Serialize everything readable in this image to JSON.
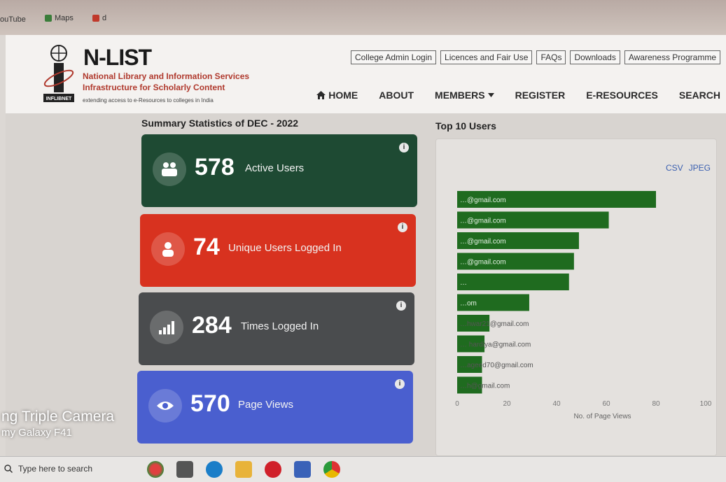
{
  "browser": {
    "bookmarks": [
      "ouTube",
      "Maps",
      "d"
    ]
  },
  "site": {
    "brand": "N-LIST",
    "subtitle_1": "National Library and Information Services",
    "subtitle_2": "Infrastructure for Scholarly Content",
    "tagline": "extending access to e-Resources to colleges in India",
    "logo_caption": "INFLIBNET"
  },
  "top_links": [
    "College Admin Login",
    "Licences and Fair Use",
    "FAQs",
    "Downloads",
    "Awareness Programme"
  ],
  "nav": {
    "home": "HOME",
    "about": "ABOUT",
    "members": "MEMBERS",
    "register": "REGISTER",
    "eresources": "E-RESOURCES",
    "search": "SEARCH"
  },
  "summary": {
    "title": "Summary Statistics of DEC - 2022",
    "cards": [
      {
        "value": "578",
        "label": "Active Users",
        "color": "#1e4a33",
        "icon": "users-icon"
      },
      {
        "value": "74",
        "label": "Unique Users Logged In",
        "color": "#d8321f",
        "icon": "user-icon"
      },
      {
        "value": "284",
        "label": "Times Logged In",
        "color": "#4a4c4e",
        "icon": "signal-icon"
      },
      {
        "value": "570",
        "label": "Page Views",
        "color": "#4a5fcf",
        "icon": "eye-icon"
      }
    ]
  },
  "top_users": {
    "title": "Top 10 Users",
    "export_csv": "CSV",
    "export_jpeg": "JPEG"
  },
  "chart_data": {
    "type": "bar",
    "orientation": "horizontal",
    "title": "Top 10 Users",
    "categories": [
      "…@gmail.com",
      "…@gmail.com",
      "…@gmail.com",
      "…@gmail.com",
      "…",
      "…om",
      "…hwar21@gmail.com",
      "… hardiya@gmail.com",
      "…ageed70@gmail.com",
      "…h@gmail.com"
    ],
    "values": [
      80,
      61,
      49,
      47,
      45,
      29,
      13,
      11,
      10,
      10
    ],
    "xlabel": "No. of Page Views",
    "xlim": [
      0,
      100
    ],
    "xticks": [
      0,
      20,
      40,
      60,
      80,
      100
    ],
    "bar_color": "#1f6b1f",
    "grid": false
  },
  "watermark": {
    "line1": "ng Triple Camera",
    "line2": "my Galaxy F41"
  },
  "taskbar": {
    "search_placeholder": "Type here to search"
  }
}
